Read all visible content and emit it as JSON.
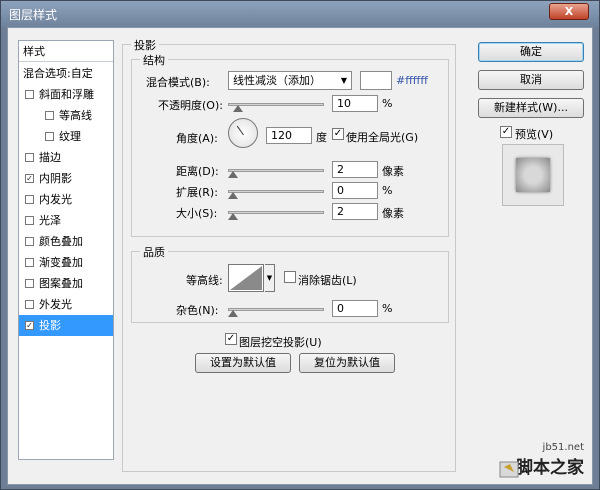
{
  "window": {
    "title": "图层样式",
    "close": "X"
  },
  "sidebar": {
    "header": "样式",
    "items": [
      {
        "label": "混合选项:自定",
        "checkbox": false
      },
      {
        "label": "斜面和浮雕",
        "checkbox": true,
        "checked": false
      },
      {
        "label": "等高线",
        "checkbox": true,
        "checked": false,
        "indent": true
      },
      {
        "label": "纹理",
        "checkbox": true,
        "checked": false,
        "indent": true
      },
      {
        "label": "描边",
        "checkbox": true,
        "checked": false
      },
      {
        "label": "内阴影",
        "checkbox": true,
        "checked": true
      },
      {
        "label": "内发光",
        "checkbox": true,
        "checked": false
      },
      {
        "label": "光泽",
        "checkbox": true,
        "checked": false
      },
      {
        "label": "颜色叠加",
        "checkbox": true,
        "checked": false
      },
      {
        "label": "渐变叠加",
        "checkbox": true,
        "checked": false
      },
      {
        "label": "图案叠加",
        "checkbox": true,
        "checked": false
      },
      {
        "label": "外发光",
        "checkbox": true,
        "checked": false
      },
      {
        "label": "投影",
        "checkbox": true,
        "checked": true,
        "selected": true
      }
    ]
  },
  "panel": {
    "title": "投影",
    "structure": {
      "title": "结构",
      "blend_mode_label": "混合模式(B):",
      "blend_mode_value": "线性减淡（添加）",
      "color_hex": "#ffffff",
      "opacity_label": "不透明度(O):",
      "opacity_value": "10",
      "opacity_unit": "%",
      "opacity_level": 0.1,
      "angle_label": "角度(A):",
      "angle_value": "120",
      "angle_unit": "度",
      "global_light_label": "使用全局光(G)",
      "global_light_checked": true,
      "distance_label": "距离(D):",
      "distance_value": "2",
      "distance_unit": "像素",
      "spread_label": "扩展(R):",
      "spread_value": "0",
      "spread_unit": "%",
      "size_label": "大小(S):",
      "size_value": "2",
      "size_unit": "像素"
    },
    "quality": {
      "title": "品质",
      "contour_label": "等高线:",
      "anti_alias_label": "消除锯齿(L)",
      "anti_alias_checked": false,
      "noise_label": "杂色(N):",
      "noise_value": "0",
      "noise_unit": "%"
    },
    "knockout_label": "图层挖空投影(U)",
    "knockout_checked": true,
    "set_default_label": "设置为默认值",
    "reset_default_label": "复位为默认值"
  },
  "actions": {
    "ok": "确定",
    "cancel": "取消",
    "new_style": "新建样式(W)...",
    "preview_label": "预览(V)",
    "preview_checked": true
  },
  "watermark": {
    "url": "jb51.net",
    "site": "脚本之家"
  }
}
